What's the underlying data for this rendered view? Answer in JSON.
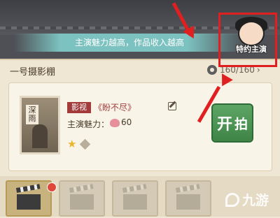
{
  "hint_banner": "主演魅力越高，作品收入越高",
  "panel": {
    "title": "一号摄影棚",
    "capacity": "160/160"
  },
  "film": {
    "poster_label": "深雨",
    "genre": "影视",
    "name": "《盼不尽》",
    "charm_label": "主演魅力：",
    "charm_value": "60",
    "start_button": [
      "开",
      "拍"
    ]
  },
  "avatar": {
    "label": "特约主演"
  },
  "watermark": "九游",
  "colors": {
    "annotation_red": "#e02020",
    "genre_tag": "#a33b3b",
    "start_green": "#4f9a57"
  }
}
